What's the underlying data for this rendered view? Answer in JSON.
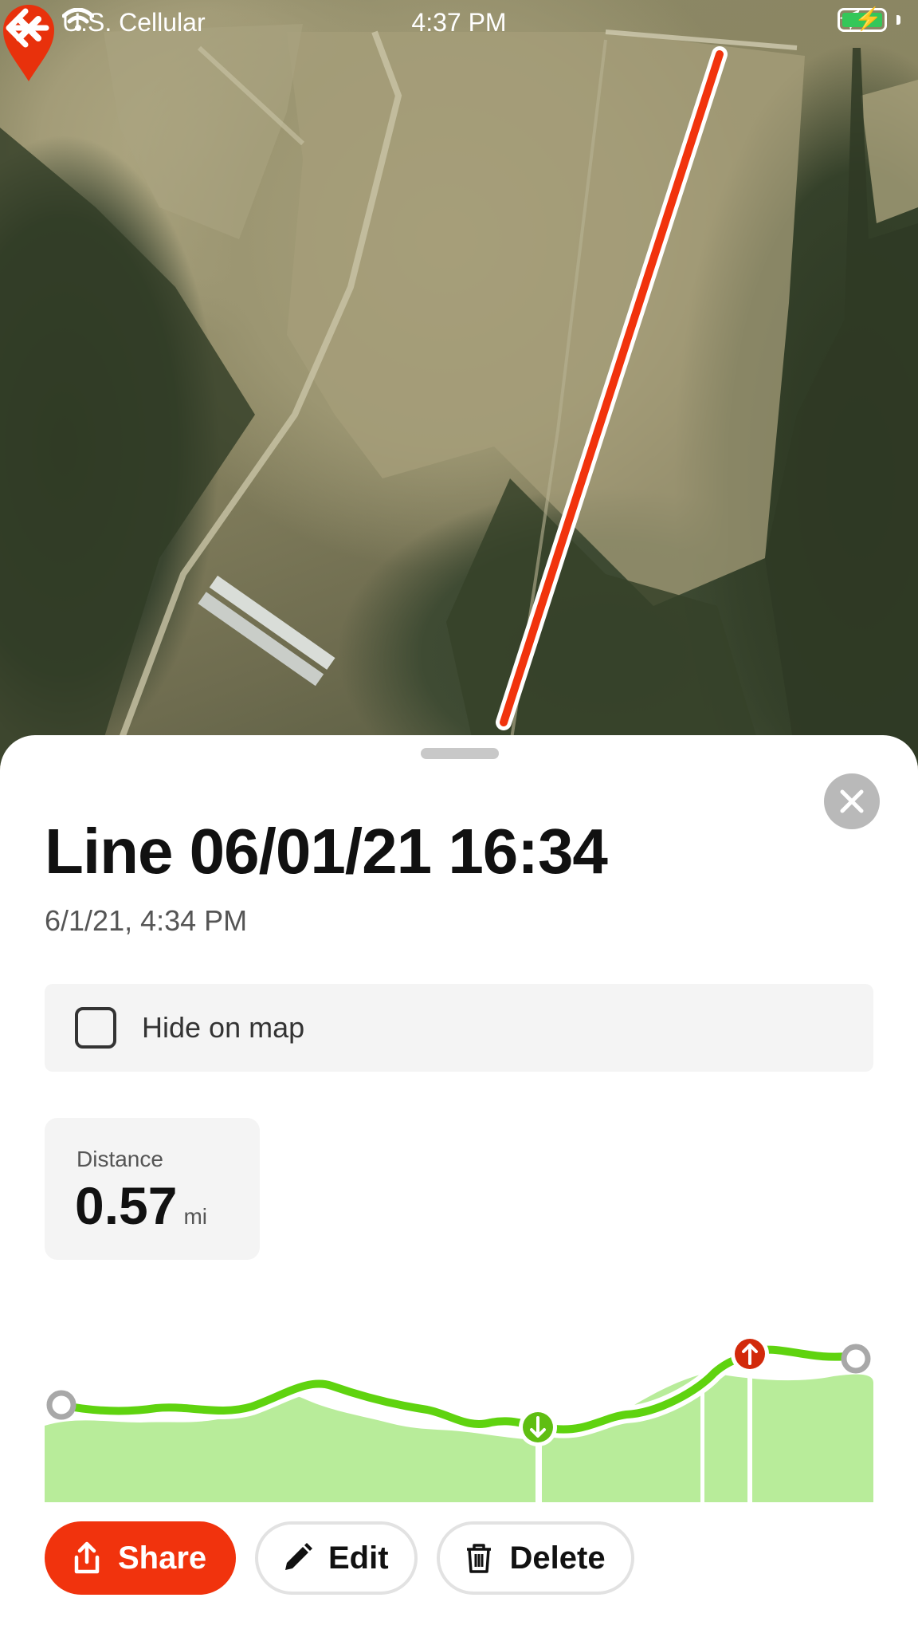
{
  "status_bar": {
    "carrier": "U.S. Cellular",
    "time": "4:37 PM"
  },
  "map": {
    "line_color": "#f1330d",
    "icons": [
      "map-pin-delete-icon",
      "back-arrow-icon"
    ]
  },
  "sheet": {
    "title": "Line 06/01/21 16:34",
    "subtitle": "6/1/21, 4:34 PM",
    "hide_label": "Hide on map",
    "hide_checked": false,
    "stat": {
      "label": "Distance",
      "value": "0.57",
      "unit": "mi"
    }
  },
  "actions": {
    "share": "Share",
    "edit": "Edit",
    "delete": "Delete"
  },
  "colors": {
    "accent": "#f1330d",
    "elevation_line": "#5fd30f",
    "elevation_fill": "#b8ec9a",
    "low_marker": "#5fbe12",
    "high_marker": "#d22a0b"
  }
}
